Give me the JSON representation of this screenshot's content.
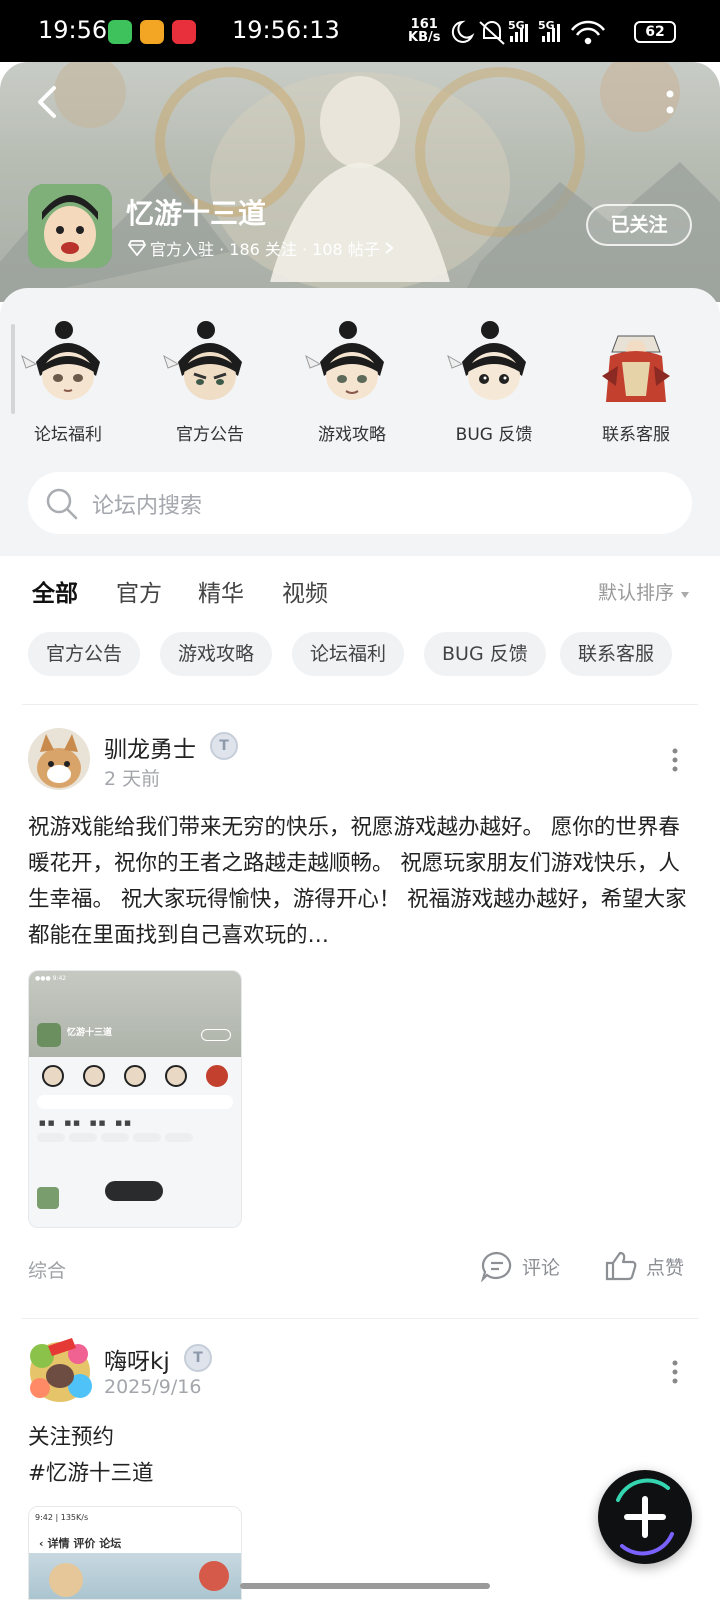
{
  "status_bar": {
    "time": "19:56",
    "clock": "19:56:13",
    "net_speed_value": "161",
    "net_speed_unit": "KB/s",
    "signal1": "5G",
    "signal2": "5G",
    "battery": "62"
  },
  "header": {
    "game_title": "忆游十三道",
    "meta": "官方入驻 · 186 关注 · 108 帖子",
    "follow_label": "已关注"
  },
  "quick_entries": [
    {
      "label": "论坛福利"
    },
    {
      "label": "官方公告"
    },
    {
      "label": "游戏攻略"
    },
    {
      "label": "BUG 反馈"
    },
    {
      "label": "联系客服"
    }
  ],
  "search": {
    "placeholder": "论坛内搜索"
  },
  "tabs": [
    {
      "label": "全部"
    },
    {
      "label": "官方"
    },
    {
      "label": "精华"
    },
    {
      "label": "视频"
    }
  ],
  "sort_label": "默认排序",
  "chips": [
    {
      "label": "官方公告"
    },
    {
      "label": "游戏攻略"
    },
    {
      "label": "论坛福利"
    },
    {
      "label": "BUG 反馈"
    },
    {
      "label": "联系客服"
    }
  ],
  "posts": [
    {
      "user": "驯龙勇士",
      "badge": "T",
      "time": "2 天前",
      "text": "祝游戏能给我们带来无穷的快乐，祝愿游戏越办越好。 愿你的世界春暖花开，祝你的王者之路越走越顺畅。 祝愿玩家朋友们游戏快乐，人生幸福。 祝大家玩得愉快，游得开心！ 祝福游戏越办越好，希望大家都能在里面找到自己喜欢玩的…",
      "image_title": "忆游十三道",
      "tag": "综合",
      "comment_label": "评论",
      "like_label": "点赞"
    },
    {
      "user": "嗨呀kj",
      "badge": "T",
      "time": "2025/9/16",
      "text_line1": "关注预约",
      "text_line2": "#忆游十三道",
      "image_status": "9:42 | 135K/s",
      "image_tabs": "详情   评价   论坛"
    }
  ]
}
